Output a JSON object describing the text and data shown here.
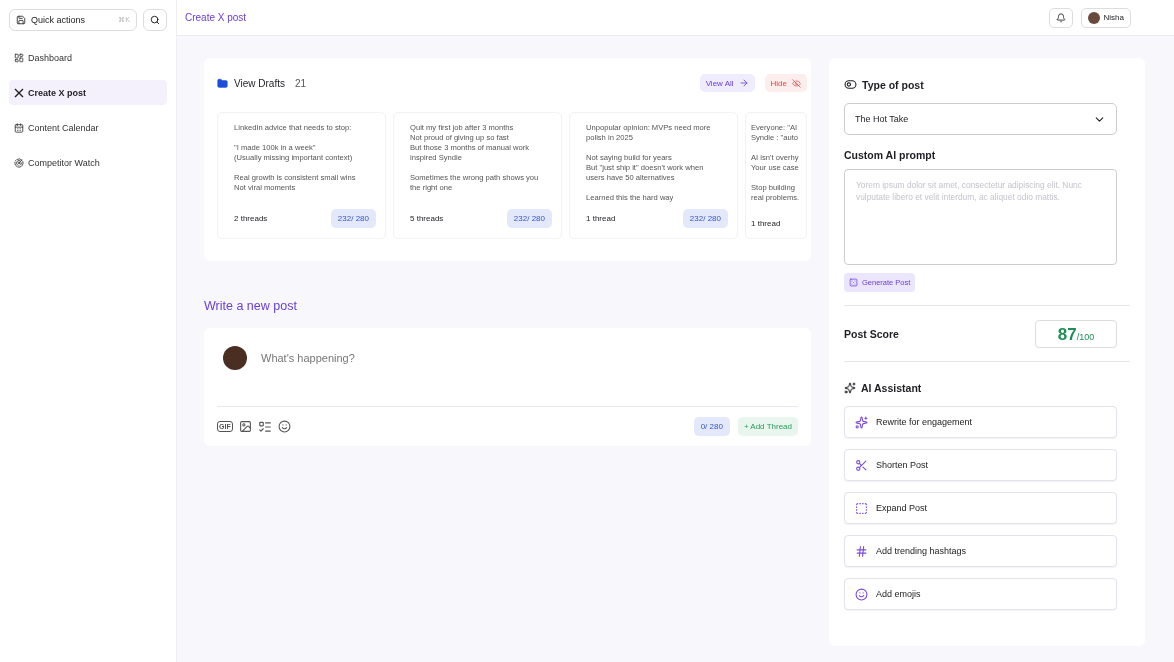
{
  "sidebar": {
    "quick_actions": {
      "label": "Quick actions",
      "shortcut": "⌘K"
    },
    "items": [
      {
        "label": "Dashboard",
        "selected": false
      },
      {
        "label": "Create X post",
        "selected": true
      },
      {
        "label": "Content Calendar",
        "selected": false
      },
      {
        "label": "Competitor Watch",
        "selected": false
      }
    ]
  },
  "header": {
    "title": "Create X post",
    "user": "Nisha"
  },
  "drafts": {
    "title": "View Drafts",
    "count": "21",
    "view_all": "View All",
    "hide": "Hide",
    "items": [
      {
        "paragraphs": [
          "LinkedIn advice that needs to stop:",
          "\"I made 100k in a week\"\n(Usually missing important context)",
          "Real growth is consistent small wins\nNot viral moments"
        ],
        "threads": "2 threads",
        "chars": "232/ 280"
      },
      {
        "paragraphs": [
          "Quit my first job after 3 months\nNot proud of giving up so fast\nBut those 3 months of manual work\ninspired Syndie",
          "Sometimes the wrong path shows you\nthe right one"
        ],
        "threads": "5 threads",
        "chars": "232/ 280"
      },
      {
        "paragraphs": [
          "Unpopular opinion: MVPs need more\npolish in 2025",
          "Not saying build for years\nBut \"just ship it\" doesn't work when\nusers have 50 alternatives",
          "Learned this the hard way"
        ],
        "threads": "1 thread",
        "chars": "232/ 280"
      },
      {
        "paragraphs": [
          "Everyone: \"AI\nSyndie : \"auto",
          "AI isn't overhy\nYour use case",
          "Stop building\nreal problems."
        ],
        "threads": "1 thread"
      }
    ]
  },
  "composer": {
    "title": "Write a new post",
    "placeholder": "What's happening?",
    "gif": "GIF",
    "chars": "0/ 280",
    "add_thread": "+ Add Thread"
  },
  "panel": {
    "type_title": "Type of post",
    "type_value": "The Hot Take",
    "prompt_title": "Custom AI prompt",
    "prompt_placeholder": "Yorem ipsum dolor sit amet, consectetur adipiscing elit. Nunc vulputate libero et velit interdum, ac aliquet odio mattis.",
    "generate": "Generate Post",
    "score_label": "Post Score",
    "score": "87",
    "score_max": "/100",
    "assistant_title": "AI Assistant",
    "actions": [
      "Rewrite for engagement",
      "Shorten Post",
      "Expand Post",
      "Add trending hashtags",
      "Add emojis"
    ]
  }
}
